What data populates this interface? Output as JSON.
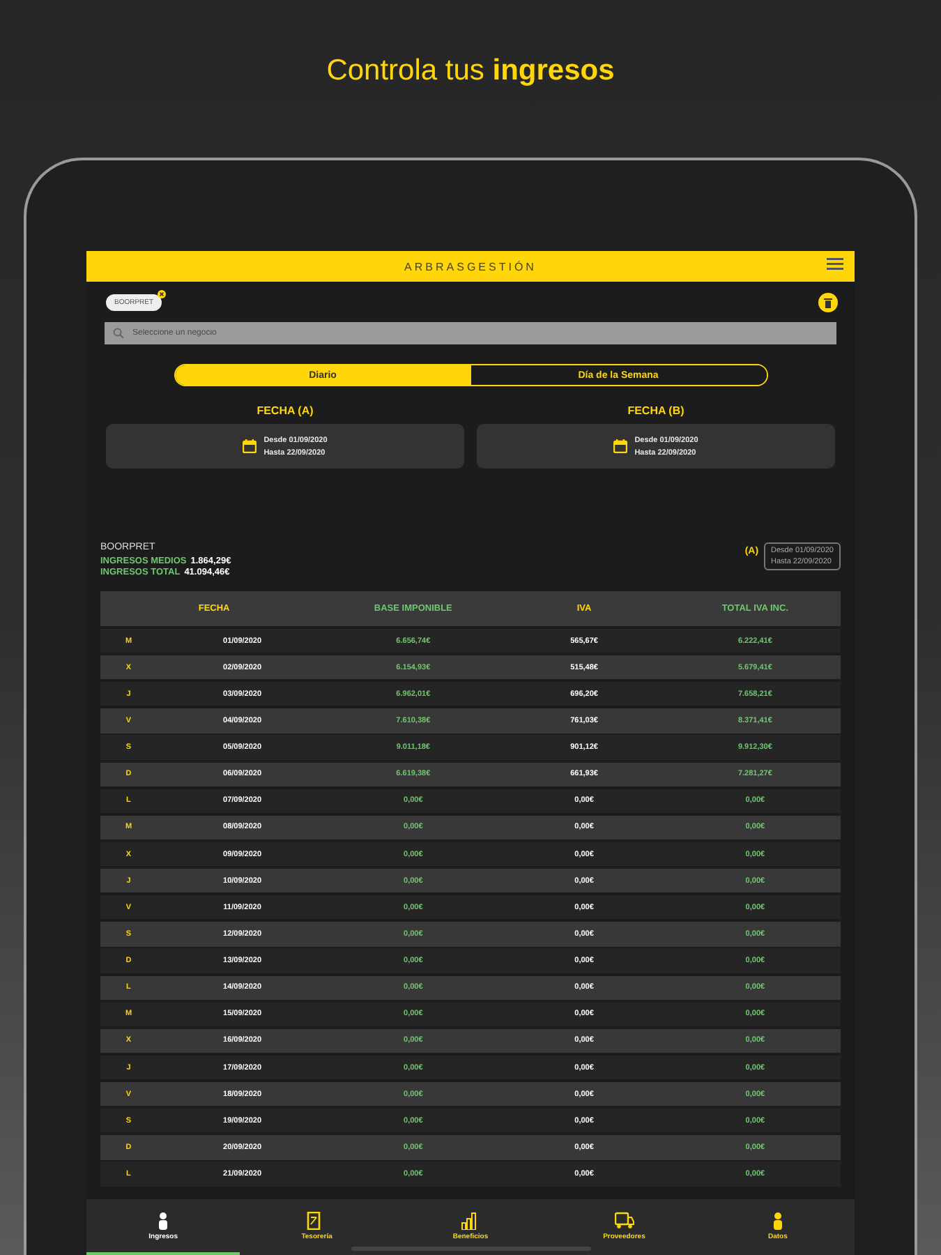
{
  "headline": "Controla tus **ingresos**",
  "app": {
    "brand": "ARBRASGESTIÓN",
    "chip": "BOORPRET",
    "search_placeholder": "Seleccione un negocio"
  },
  "segments": [
    {
      "label": "Diario",
      "selected": true
    },
    {
      "label": "Día de la Semana",
      "selected": false
    }
  ],
  "date_panels": [
    {
      "title": "FECHA (A)",
      "from": "Desde 01/09/2020",
      "to": "Hasta 22/09/2020"
    },
    {
      "title": "FECHA (B)",
      "from": "Desde 01/09/2020",
      "to": "Hasta 22/09/2020"
    }
  ],
  "summary": {
    "business": "BOORPRET",
    "stats": [
      {
        "label": "INGRESOS MEDIOS",
        "value": "1.864,29€"
      },
      {
        "label": "INGRESOS TOTAL",
        "value": "41.094,46€"
      }
    ],
    "range_tag": "(A)",
    "range_from": "Desde 01/09/2020",
    "range_to": "Hasta 22/09/2020"
  },
  "table": {
    "columns": [
      "FECHA",
      "BASE IMPONIBLE",
      "IVA",
      "TOTAL IVA INC."
    ],
    "rows": [
      {
        "day": "M",
        "date": "01/09/2020",
        "base": "6.656,74€",
        "iva": "565,67€",
        "total": "6.222,41€"
      },
      {
        "day": "X",
        "date": "02/09/2020",
        "base": "6.154,93€",
        "iva": "515,48€",
        "total": "5.679,41€"
      },
      {
        "day": "J",
        "date": "03/09/2020",
        "base": "6.962,01€",
        "iva": "696,20€",
        "total": "7.658,21€"
      },
      {
        "day": "V",
        "date": "04/09/2020",
        "base": "7.610,38€",
        "iva": "761,03€",
        "total": "8.371,41€"
      },
      {
        "day": "S",
        "date": "05/09/2020",
        "base": "9.011,18€",
        "iva": "901,12€",
        "total": "9.912,30€"
      },
      {
        "day": "D",
        "date": "06/09/2020",
        "base": "6.619,38€",
        "iva": "661,93€",
        "total": "7.281,27€"
      },
      {
        "day": "L",
        "date": "07/09/2020",
        "base": "0,00€",
        "iva": "0,00€",
        "total": "0,00€"
      },
      {
        "day": "M",
        "date": "08/09/2020",
        "base": "0,00€",
        "iva": "0,00€",
        "total": "0,00€"
      },
      {
        "day": "X",
        "date": "09/09/2020",
        "base": "0,00€",
        "iva": "0,00€",
        "total": "0,00€"
      },
      {
        "day": "J",
        "date": "10/09/2020",
        "base": "0,00€",
        "iva": "0,00€",
        "total": "0,00€"
      },
      {
        "day": "V",
        "date": "11/09/2020",
        "base": "0,00€",
        "iva": "0,00€",
        "total": "0,00€"
      },
      {
        "day": "S",
        "date": "12/09/2020",
        "base": "0,00€",
        "iva": "0,00€",
        "total": "0,00€"
      },
      {
        "day": "D",
        "date": "13/09/2020",
        "base": "0,00€",
        "iva": "0,00€",
        "total": "0,00€"
      },
      {
        "day": "L",
        "date": "14/09/2020",
        "base": "0,00€",
        "iva": "0,00€",
        "total": "0,00€"
      },
      {
        "day": "M",
        "date": "15/09/2020",
        "base": "0,00€",
        "iva": "0,00€",
        "total": "0,00€"
      },
      {
        "day": "X",
        "date": "16/09/2020",
        "base": "0,00€",
        "iva": "0,00€",
        "total": "0,00€"
      },
      {
        "day": "J",
        "date": "17/09/2020",
        "base": "0,00€",
        "iva": "0,00€",
        "total": "0,00€"
      },
      {
        "day": "V",
        "date": "18/09/2020",
        "base": "0,00€",
        "iva": "0,00€",
        "total": "0,00€"
      },
      {
        "day": "S",
        "date": "19/09/2020",
        "base": "0,00€",
        "iva": "0,00€",
        "total": "0,00€"
      },
      {
        "day": "D",
        "date": "20/09/2020",
        "base": "0,00€",
        "iva": "0,00€",
        "total": "0,00€"
      },
      {
        "day": "L",
        "date": "21/09/2020",
        "base": "0,00€",
        "iva": "0,00€",
        "total": "0,00€"
      }
    ]
  },
  "nav": [
    {
      "label": "Ingresos",
      "selected": true
    },
    {
      "label": "Tesorería",
      "selected": false
    },
    {
      "label": "Beneficios",
      "selected": false
    },
    {
      "label": "Proveedores",
      "selected": false
    },
    {
      "label": "Datos",
      "selected": false
    }
  ]
}
